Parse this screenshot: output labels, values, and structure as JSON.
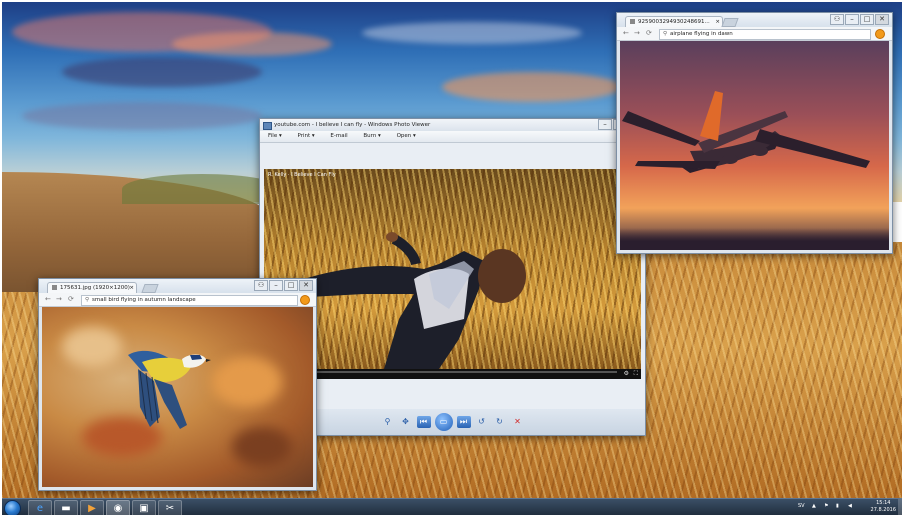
{
  "photo_viewer": {
    "title": "youtube.com - I believe I can fly - Windows Photo Viewer",
    "menu": [
      "File ▾",
      "Print ▾",
      "E-mail",
      "Burn ▾",
      "Open ▾"
    ],
    "video_caption": "R. Kelly · I Believe I Can Fly",
    "controls": [
      "zoom-icon",
      "fit-icon",
      "previous-icon",
      "slideshow-icon",
      "next-icon",
      "rotate-left-icon",
      "rotate-right-icon",
      "delete-icon"
    ]
  },
  "airplane_window": {
    "tab_title": "9259003294930248691...",
    "address": "airplane flying in dawn"
  },
  "bird_window": {
    "tab_title": "175631.jpg (1920×1200)",
    "address": "small bird flying in autumn landscape"
  },
  "taskbar": {
    "start": "start-orb",
    "pinned": [
      "internet-explorer-icon",
      "windows-explorer-icon",
      "media-player-icon",
      "chrome-icon",
      "photo-viewer-icon",
      "snipping-tool-icon"
    ],
    "tray_lang": "SV",
    "time": "15:14",
    "date": "27.8.2016"
  }
}
